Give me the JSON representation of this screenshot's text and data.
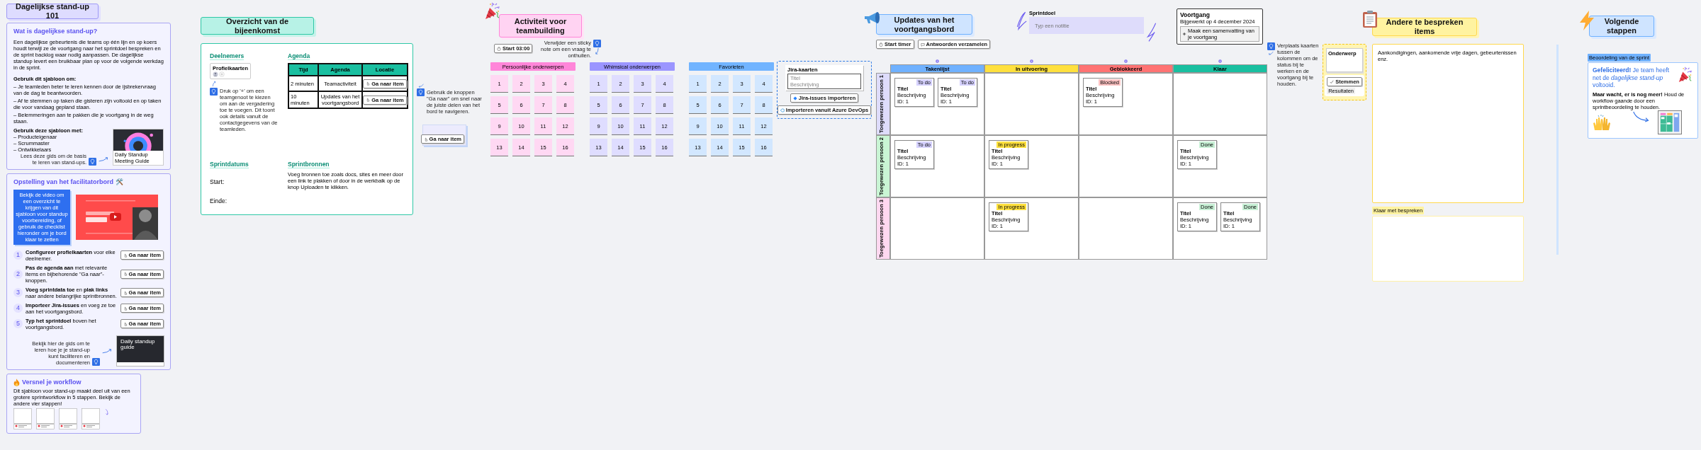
{
  "intro": {
    "title": "Dagelijkse stand-up 101",
    "about": {
      "heading": "Wat is dagelijkse stand-up?",
      "text": "Een dagelijkse gebeurtenis die teams op één lijn en op koers houdt terwijl ze de voortgang naar het sprintdoel bespreken en de sprint backlog waar nodig aanpassen. De dagelijkse standup levert een bruikbaar plan op voor de volgende werkdag in de sprint.",
      "lists": [
        {
          "heading": "Gebruik dit sjabloon om:",
          "items": [
            "– Je teamleden beter te leren kennen door de ijsbrekervraag van de dag te beantwoorden.",
            "– Af te stemmen op taken die gisteren zijn voltooid en op taken die voor vandaag gepland staan.",
            "– Belemmeringen aan te pakken die je voortgang in de weg staan."
          ]
        },
        {
          "heading": "Gebruik deze sjabloon met:",
          "items": [
            "– Producteigenaar",
            "– Scrummaster",
            "– Ontwikkelaars"
          ]
        }
      ],
      "tip": "Lees deze gids om de basis te leren van stand-ups.",
      "link_caption": "Daily Standup Meeting Guide"
    },
    "setup": {
      "heading": "Opstelling van het facilitatorbord 🛠️",
      "note": "Bekijk de video om een overzicht te krijgen van dit sjabloon voor standup voorbereiding, of gebruik de checklist hieronder om je bord klaar te zetten",
      "steps": [
        {
          "number": "1",
          "text": "**Configureer profielkaarten** voor elke deelnemer.",
          "button": "Ga naar item"
        },
        {
          "number": "2",
          "text": "**Pas de agenda aan** met relevante items en bijbehorende \"Ga naar\"-knoppen.",
          "button": "Ga naar item"
        },
        {
          "number": "3",
          "text": "**Voeg sprintdata toe** en **plak links** naar andere belangrijke sprintbronnen.",
          "button": "Ga naar item"
        },
        {
          "number": "4",
          "text": "**Importeer Jira-issues** en voeg ze toe aan het voortgangsbord.",
          "button": "Ga naar item"
        },
        {
          "number": "5",
          "text": "**Typ het sprintdoel** boven het voortgangsbord.",
          "button": "Ga naar item"
        }
      ],
      "tip": "Bekijk hier de gids om te leren hoe je je stand-up kunt faciliteren en documenteren",
      "guide": "Daily standup guide"
    },
    "workflow": {
      "heading": "Versnel je workflow",
      "text": "Dit sjabloon voor stand-up maakt deel uit van een grotere sprintworkflow in 5 stappen. Bekijk de andere vier stappen!"
    }
  },
  "overview": {
    "title": "Overzicht van de bijeenkomst",
    "participants": "Deelnemers",
    "profile_label": "Profielkaarten",
    "participants_tip": "Druk op '+' om een teamgenoot te kiezen om aan de vergadering toe te voegen. Dit toont ook details vanuit de contactgegevens van de teamleden.",
    "agenda": "Agenda",
    "columns": [
      "Tijd",
      "Agenda",
      "Locatie"
    ],
    "rows": [
      {
        "time": "2 minuten",
        "item": "Teamactiviteit",
        "button": "Ga naar item"
      },
      {
        "time": "10 minuten",
        "item": "Updates van het voortgangsbord",
        "button": "Ga naar item"
      }
    ],
    "dates": "Sprintdatums",
    "start": "Start:",
    "end": "Einde:",
    "resources": "Sprintbronnen",
    "resources_text": "Voeg bronnen toe zoals docs, sites en meer door een link te plakken of door in de werkbalk op de knop Uploaden te klikken.",
    "side_tip": "Gebruik de knoppen \"Ga naar\" om snel naar de juiste delen van het bord te navigeren.",
    "side_button": "Ga naar item"
  },
  "teambuilding": {
    "title": "Activiteit voor teambuilding",
    "timer": "Start 03:00",
    "tip": "Verwijder een sticky note om een vraag te onthullen.",
    "groups": [
      {
        "label": "Persoonlijke onderwerpen",
        "color": "#ff86d9",
        "notes": [
          "1",
          "2",
          "3",
          "4",
          "5",
          "6",
          "7",
          "8",
          "9",
          "10",
          "11",
          "12",
          "13",
          "14",
          "15",
          "16"
        ]
      },
      {
        "label": "Whimsical onderwerpen",
        "color": "#9b95ff",
        "notes": [
          "1",
          "2",
          "3",
          "4",
          "5",
          "6",
          "7",
          "8",
          "9",
          "10",
          "11",
          "12",
          "13",
          "14",
          "15",
          "16"
        ]
      },
      {
        "label": "Favorieten",
        "color": "#71b4ff",
        "notes": [
          "1",
          "2",
          "3",
          "4",
          "5",
          "6",
          "7",
          "8",
          "9",
          "10",
          "11",
          "12",
          "13",
          "14",
          "15",
          "16"
        ]
      }
    ]
  },
  "progress": {
    "title": "Updates van het voortgangsbord",
    "buttons": [
      "Start timer",
      "Antwoorden verzamelen"
    ],
    "goal_label": "Sprintdoel",
    "goal_placeholder": "Typ een notitie",
    "summary": {
      "title": "Voortgang",
      "updated": "Bijgewerkt op 4 december 2024",
      "action": "Maak een samenvatting van je voortgang"
    },
    "tip": "Verplaats kaarten tussen de kolommen om de status bij te werken en de voortgang bij te houden.",
    "import": {
      "card_title": "Jira-kaarten",
      "field_placeholder": "Titel",
      "field_hint": "Beschrijving",
      "buttons": [
        "Jira-issues importeren",
        "Importeren vanuit Azure DevOps"
      ]
    },
    "columns": [
      {
        "label": "Takenlijst",
        "color": "#6fb1ff"
      },
      {
        "label": "In uitvoering",
        "color": "#ffe03d"
      },
      {
        "label": "Geblokkeerd",
        "color": "#ff7373"
      },
      {
        "label": "Klaar",
        "color": "#19bfa0"
      }
    ],
    "rows": [
      {
        "label": "Toegewezen persoon 1",
        "color": "#dedcfb",
        "cards": [
          {
            "kind": "todo",
            "title": "Titel",
            "description": "Beschrijving",
            "tag": "To do",
            "id": "ID: 1"
          },
          {
            "kind": "todo",
            "title": "Titel",
            "description": "Beschrijving",
            "tag": "To do",
            "id": "ID: 1"
          },
          {
            "kind": "blocked",
            "title": "Titel",
            "description": "Beschrijving",
            "tag": "Blocked",
            "id": "ID: 1"
          }
        ]
      },
      {
        "label": "Toegewezen persoon 2",
        "color": "#c9f5d4",
        "cards": [
          {
            "kind": "todo",
            "title": "Titel",
            "description": "Beschrijving",
            "tag": "To do",
            "id": "ID: 1"
          },
          {
            "kind": "progress",
            "title": "Titel",
            "description": "Beschrijving",
            "tag": "In progress",
            "id": "ID: 1"
          },
          {
            "kind": "done",
            "title": "Titel",
            "description": "Beschrijving",
            "tag": "Done",
            "id": "ID: 1"
          }
        ]
      },
      {
        "label": "Toegewezen persoon 3",
        "color": "#ffd8f0",
        "cards": [
          {
            "kind": "progress",
            "title": "Titel",
            "description": "Beschrijving",
            "tag": "In progress",
            "id": "ID: 1"
          },
          {
            "kind": "done",
            "title": "Titel",
            "description": "Beschrijving",
            "tag": "Done",
            "id": "ID: 1"
          },
          {
            "kind": "done",
            "title": "Titel",
            "description": "Beschrijving",
            "tag": "Done",
            "id": "ID: 1"
          }
        ]
      }
    ]
  },
  "discussion": {
    "title": "Andere te bespreken items",
    "side_card": "Onderwerp",
    "side_buttons": [
      "Stemmen",
      "Resultaten"
    ],
    "text": "Aankondigingen, aankomende vrije dagen, gebeurtenissen enz.",
    "done_label": "Klaar met bespreken"
  },
  "next_steps": {
    "title": "Volgende stappen",
    "label": "Beoordeling van de sprint",
    "message": "**Gefeliciteerd!** Je team heeft net de *dagelijkse stand-up* voltooid.",
    "text": "**Maar wacht, er is nog meer!** Houd de workflow gaande door een sprintbeoordeling te houden."
  }
}
